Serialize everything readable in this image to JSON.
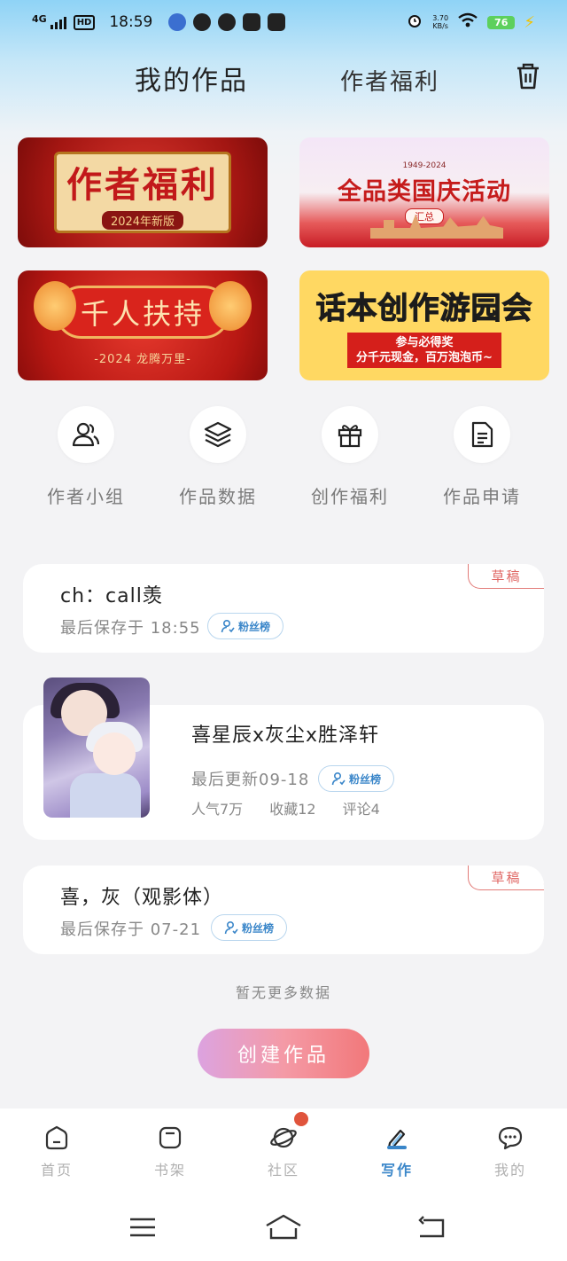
{
  "status_bar": {
    "network": "4G",
    "hd": "HD",
    "time": "18:59",
    "speed": "3.70",
    "speed_unit": "KB/s",
    "battery": "76"
  },
  "header": {
    "tab_main": "我的作品",
    "tab_alt": "作者福利"
  },
  "banners": {
    "b1": {
      "title": "作者福利",
      "sub": "2024年新版"
    },
    "b2": {
      "years": "1949-2024",
      "title": "全品类国庆活动",
      "sub": "汇总"
    },
    "b3": {
      "title": "千人扶持",
      "sub": "-2024 龙腾万里-"
    },
    "b4": {
      "title": "话本创作游园会",
      "sub1": "参与必得奖",
      "sub2": "分千元现金，百万泡泡币~"
    }
  },
  "quick_links": [
    {
      "label": "作者小组",
      "icon": "users-icon"
    },
    {
      "label": "作品数据",
      "icon": "layers-icon"
    },
    {
      "label": "创作福利",
      "icon": "gift-icon"
    },
    {
      "label": "作品申请",
      "icon": "document-icon"
    }
  ],
  "works": [
    {
      "title": "ch：call羡",
      "meta": "最后保存于 18:55",
      "badge": "草稿",
      "fans_label": "粉丝榜"
    },
    {
      "title": "喜星辰x灰尘x胜泽轩",
      "meta": "最后更新09-18",
      "fans_label": "粉丝榜",
      "stats": {
        "popularity": "人气7万",
        "favorites": "收藏12",
        "comments": "评论4"
      }
    },
    {
      "title": "喜，灰（观影体）",
      "meta": "最后保存于 07-21",
      "badge": "草稿",
      "fans_label": "粉丝榜"
    }
  ],
  "no_more": "暂无更多数据",
  "create_button": "创建作品",
  "bottom_nav": [
    {
      "label": "首页",
      "icon": "home-icon"
    },
    {
      "label": "书架",
      "icon": "bookshelf-icon"
    },
    {
      "label": "社区",
      "icon": "planet-icon"
    },
    {
      "label": "写作",
      "icon": "pen-icon",
      "active": true
    },
    {
      "label": "我的",
      "icon": "chat-icon"
    }
  ],
  "colors": {
    "accent_blue": "#3a86c9",
    "draft_red": "#e06764",
    "notification": "#e0543c"
  }
}
